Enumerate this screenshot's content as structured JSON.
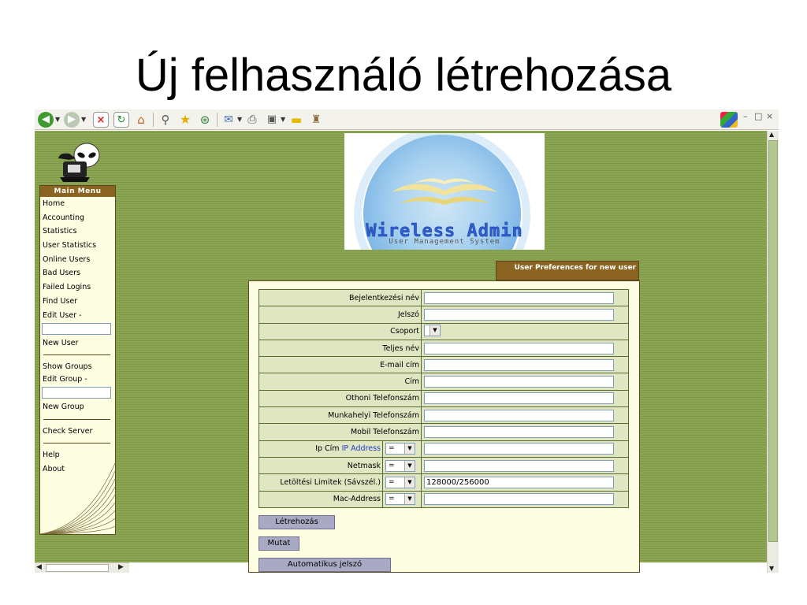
{
  "slide": {
    "title": "Új felhasználó létrehozása"
  },
  "toolbar": {
    "icons": [
      "back-icon",
      "forward-icon",
      "stop-icon",
      "refresh-icon",
      "home-icon",
      "search-icon",
      "favorites-icon",
      "history-icon",
      "mail-icon",
      "print-icon",
      "edit-icon",
      "folder-icon",
      "messenger-icon",
      "windows-flag-icon"
    ],
    "window_controls": {
      "minimize": "–",
      "restore": "□",
      "close": "×"
    }
  },
  "menu": {
    "title": "Main Menu",
    "items": {
      "home": "Home",
      "accounting": "Accounting",
      "statistics": "Statistics",
      "user_statistics": "User Statistics",
      "online_users": "Online Users",
      "bad_users": "Bad Users",
      "failed_logins": "Failed Logins",
      "find_user": "Find User",
      "edit_user": "Edit User -",
      "new_user": "New User",
      "show_groups": "Show Groups",
      "edit_group": "Edit Group -",
      "new_group": "New Group",
      "check_server": "Check Server",
      "help": "Help",
      "about": "About"
    }
  },
  "logo": {
    "title": "Wireless Admin",
    "subtitle": "User Management System"
  },
  "preferences_tab": "User Preferences for new user",
  "form": {
    "fields": [
      {
        "label": "Bejelentkezési név",
        "value": ""
      },
      {
        "label": "Jelszó",
        "value": ""
      },
      {
        "label": "Csoport",
        "value": ""
      },
      {
        "label": "Teljes név",
        "value": ""
      },
      {
        "label": "E-mail cím",
        "value": ""
      },
      {
        "label": "Cím",
        "value": ""
      },
      {
        "label": "Othoni Telefonszám",
        "value": ""
      },
      {
        "label": "Munkahelyi Telefonszám",
        "value": ""
      },
      {
        "label": "Mobil Telefonszám",
        "value": ""
      },
      {
        "label": "Ip Cím",
        "link": "IP Address",
        "operator": "=",
        "value": ""
      },
      {
        "label": "Netmask",
        "operator": "=",
        "value": ""
      },
      {
        "label": "Letöltési Limitek (Sávszél.)",
        "operator": "=",
        "value": "128000/256000"
      },
      {
        "label": "Mac-Address",
        "operator": "=",
        "value": ""
      }
    ],
    "buttons": {
      "create": "Létrehozás",
      "show": "Mutat",
      "auto_password": "Automatikus jelszó"
    }
  },
  "colors": {
    "background_green": "#8ca552",
    "menu_header_brown": "#8a6420",
    "panel_cream": "#fdfde2",
    "field_green": "#dfe6c1",
    "button_lavender": "#a9a9c4"
  }
}
